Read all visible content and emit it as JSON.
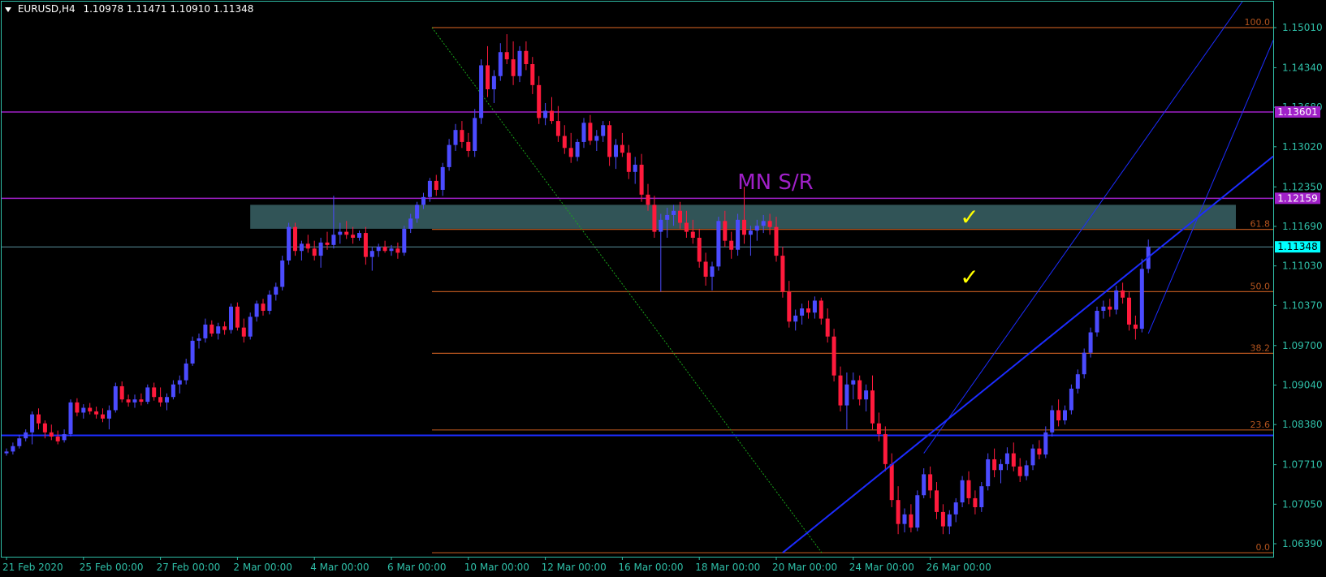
{
  "header": {
    "symbol": "EURUSD,H4",
    "ohlc": "1.10978 1.11471 1.10910 1.11348"
  },
  "colors": {
    "background": "#000000",
    "axis": "#2fbfa8",
    "bull": "#4b4bff",
    "bear": "#ff1a3c",
    "fib": "#b4541e",
    "sr": "#a020c8",
    "trend": "#1c2cff",
    "zone": "#3a6366",
    "check": "#ffff00",
    "price_box": "#00ffff"
  },
  "chart_data": {
    "type": "candlestick",
    "y_ticks": [
      "1.15010",
      "1.14340",
      "1.13680",
      "1.13020",
      "1.12350",
      "1.11690",
      "1.11030",
      "1.10370",
      "1.09700",
      "1.09040",
      "1.08380",
      "1.07710",
      "1.07050",
      "1.06390"
    ],
    "ylim": [
      1.0615,
      1.1551
    ],
    "x_ticks": [
      {
        "label": "21 Feb 2020",
        "index": 0
      },
      {
        "label": "25 Feb 00:00",
        "index": 12
      },
      {
        "label": "27 Feb 00:00",
        "index": 24
      },
      {
        "label": "2 Mar 00:00",
        "index": 36
      },
      {
        "label": "4 Mar 00:00",
        "index": 48
      },
      {
        "label": "6 Mar 00:00",
        "index": 60
      },
      {
        "label": "10 Mar 00:00",
        "index": 72
      },
      {
        "label": "12 Mar 00:00",
        "index": 84
      },
      {
        "label": "16 Mar 00:00",
        "index": 96
      },
      {
        "label": "18 Mar 00:00",
        "index": 108
      },
      {
        "label": "20 Mar 00:00",
        "index": 120
      },
      {
        "label": "24 Mar 00:00",
        "index": 132
      },
      {
        "label": "26 Mar 00:00",
        "index": 144
      }
    ],
    "candles": [
      [
        1.079,
        1.0798,
        1.0786,
        1.0793
      ],
      [
        1.0793,
        1.0808,
        1.0788,
        1.0802
      ],
      [
        1.0802,
        1.0821,
        1.0798,
        1.0815
      ],
      [
        1.0815,
        1.083,
        1.081,
        1.0825
      ],
      [
        1.0825,
        1.086,
        1.0805,
        1.0855
      ],
      [
        1.0855,
        1.0865,
        1.083,
        1.084
      ],
      [
        1.084,
        1.0845,
        1.0815,
        1.0825
      ],
      [
        1.0825,
        1.0838,
        1.0812,
        1.0818
      ],
      [
        1.0818,
        1.0828,
        1.0805,
        1.081
      ],
      [
        1.0812,
        1.083,
        1.0808,
        1.0822
      ],
      [
        1.0822,
        1.088,
        1.0818,
        1.0875
      ],
      [
        1.0875,
        1.0882,
        1.0852,
        1.0858
      ],
      [
        1.0858,
        1.0872,
        1.0848,
        1.0866
      ],
      [
        1.0866,
        1.0874,
        1.0855,
        1.086
      ],
      [
        1.086,
        1.0868,
        1.0848,
        1.0855
      ],
      [
        1.0855,
        1.0865,
        1.0842,
        1.0848
      ],
      [
        1.0848,
        1.087,
        1.083,
        1.0862
      ],
      [
        1.0862,
        1.0908,
        1.0858,
        1.0902
      ],
      [
        1.0902,
        1.091,
        1.0875,
        1.088
      ],
      [
        1.088,
        1.0888,
        1.0868,
        1.0875
      ],
      [
        1.0875,
        1.0888,
        1.0866,
        1.088
      ],
      [
        1.088,
        1.089,
        1.087,
        1.0876
      ],
      [
        1.0876,
        1.0905,
        1.0872,
        1.09
      ],
      [
        1.09,
        1.0908,
        1.0878,
        1.0884
      ],
      [
        1.0884,
        1.09,
        1.0868,
        1.0875
      ],
      [
        1.0875,
        1.089,
        1.0862,
        1.0884
      ],
      [
        1.0884,
        1.0912,
        1.088,
        1.0905
      ],
      [
        1.0905,
        1.092,
        1.089,
        1.0912
      ],
      [
        1.0912,
        1.0948,
        1.0905,
        1.094
      ],
      [
        1.094,
        1.0985,
        1.0936,
        1.0978
      ],
      [
        1.0978,
        1.099,
        1.0965,
        1.0982
      ],
      [
        1.0982,
        1.1015,
        1.0975,
        1.1005
      ],
      [
        1.1005,
        1.1012,
        1.0985,
        1.099
      ],
      [
        1.099,
        1.1008,
        1.098,
        1.1002
      ],
      [
        1.1002,
        1.101,
        1.0988,
        1.0996
      ],
      [
        1.0996,
        1.104,
        1.099,
        1.1035
      ],
      [
        1.1035,
        1.1042,
        1.0995,
        1.1
      ],
      [
        1.1,
        1.1015,
        1.0975,
        1.0985
      ],
      [
        1.0985,
        1.1025,
        1.098,
        1.1018
      ],
      [
        1.1018,
        1.1045,
        1.101,
        1.104
      ],
      [
        1.104,
        1.1048,
        1.102,
        1.1028
      ],
      [
        1.1028,
        1.1062,
        1.1022,
        1.1055
      ],
      [
        1.1055,
        1.1075,
        1.1045,
        1.1068
      ],
      [
        1.1068,
        1.112,
        1.1062,
        1.1112
      ],
      [
        1.1112,
        1.1175,
        1.1105,
        1.1168
      ],
      [
        1.1168,
        1.1175,
        1.112,
        1.1128
      ],
      [
        1.1128,
        1.1145,
        1.1112,
        1.114
      ],
      [
        1.114,
        1.1155,
        1.1125,
        1.1132
      ],
      [
        1.1132,
        1.1145,
        1.1112,
        1.112
      ],
      [
        1.112,
        1.115,
        1.11,
        1.1142
      ],
      [
        1.1142,
        1.116,
        1.113,
        1.1138
      ],
      [
        1.1138,
        1.122,
        1.1132,
        1.1155
      ],
      [
        1.1155,
        1.1175,
        1.114,
        1.116
      ],
      [
        1.116,
        1.1178,
        1.1148,
        1.1155
      ],
      [
        1.1155,
        1.1168,
        1.114,
        1.115
      ],
      [
        1.115,
        1.1162,
        1.1145,
        1.1158
      ],
      [
        1.1158,
        1.1168,
        1.1105,
        1.1118
      ],
      [
        1.1118,
        1.1135,
        1.1095,
        1.1128
      ],
      [
        1.1128,
        1.114,
        1.1118,
        1.1135
      ],
      [
        1.1135,
        1.1145,
        1.1125,
        1.1128
      ],
      [
        1.1128,
        1.1138,
        1.112,
        1.1132
      ],
      [
        1.1132,
        1.1142,
        1.1115,
        1.1125
      ],
      [
        1.1125,
        1.117,
        1.112,
        1.1165
      ],
      [
        1.1165,
        1.119,
        1.1158,
        1.1182
      ],
      [
        1.1182,
        1.121,
        1.1175,
        1.1205
      ],
      [
        1.1205,
        1.1225,
        1.1198,
        1.1218
      ],
      [
        1.1218,
        1.125,
        1.121,
        1.1245
      ],
      [
        1.1245,
        1.1255,
        1.122,
        1.123
      ],
      [
        1.123,
        1.1275,
        1.122,
        1.1268
      ],
      [
        1.1268,
        1.1315,
        1.1262,
        1.1305
      ],
      [
        1.1305,
        1.134,
        1.1295,
        1.133
      ],
      [
        1.133,
        1.1345,
        1.13,
        1.131
      ],
      [
        1.131,
        1.1325,
        1.1285,
        1.1295
      ],
      [
        1.1295,
        1.1365,
        1.1285,
        1.135
      ],
      [
        1.135,
        1.1448,
        1.134,
        1.1438
      ],
      [
        1.1438,
        1.147,
        1.1385,
        1.1398
      ],
      [
        1.1398,
        1.143,
        1.1375,
        1.142
      ],
      [
        1.142,
        1.1475,
        1.1412,
        1.146
      ],
      [
        1.146,
        1.149,
        1.144,
        1.1448
      ],
      [
        1.1448,
        1.1478,
        1.1405,
        1.142
      ],
      [
        1.142,
        1.147,
        1.141,
        1.1462
      ],
      [
        1.1462,
        1.1478,
        1.143,
        1.144
      ],
      [
        1.144,
        1.1452,
        1.139,
        1.1405
      ],
      [
        1.1405,
        1.142,
        1.134,
        1.135
      ],
      [
        1.135,
        1.1375,
        1.1338,
        1.1362
      ],
      [
        1.1362,
        1.1385,
        1.134,
        1.1345
      ],
      [
        1.1345,
        1.137,
        1.131,
        1.132
      ],
      [
        1.132,
        1.1338,
        1.129,
        1.13
      ],
      [
        1.13,
        1.1325,
        1.1275,
        1.1285
      ],
      [
        1.1285,
        1.1315,
        1.1278,
        1.131
      ],
      [
        1.131,
        1.135,
        1.13,
        1.1342
      ],
      [
        1.1342,
        1.1355,
        1.1305,
        1.1312
      ],
      [
        1.1312,
        1.133,
        1.1295,
        1.132
      ],
      [
        1.132,
        1.1345,
        1.131,
        1.1338
      ],
      [
        1.1338,
        1.1345,
        1.127,
        1.1285
      ],
      [
        1.1285,
        1.1315,
        1.1265,
        1.1305
      ],
      [
        1.1305,
        1.1325,
        1.1285,
        1.1292
      ],
      [
        1.1292,
        1.1305,
        1.1248,
        1.126
      ],
      [
        1.126,
        1.1285,
        1.124,
        1.1272
      ],
      [
        1.1272,
        1.129,
        1.121,
        1.1222
      ],
      [
        1.1222,
        1.124,
        1.1195,
        1.1205
      ],
      [
        1.1205,
        1.122,
        1.115,
        1.116
      ],
      [
        1.116,
        1.119,
        1.106,
        1.118
      ],
      [
        1.118,
        1.12,
        1.115,
        1.1188
      ],
      [
        1.1188,
        1.1205,
        1.117,
        1.1195
      ],
      [
        1.1195,
        1.121,
        1.1165,
        1.1175
      ],
      [
        1.1175,
        1.1195,
        1.115,
        1.116
      ],
      [
        1.116,
        1.118,
        1.114,
        1.115
      ],
      [
        1.115,
        1.1165,
        1.11,
        1.111
      ],
      [
        1.111,
        1.1125,
        1.107,
        1.1085
      ],
      [
        1.1085,
        1.111,
        1.1062,
        1.1102
      ],
      [
        1.1102,
        1.1185,
        1.1095,
        1.1178
      ],
      [
        1.1178,
        1.1195,
        1.1135,
        1.1145
      ],
      [
        1.1145,
        1.116,
        1.1115,
        1.113
      ],
      [
        1.113,
        1.119,
        1.112,
        1.118
      ],
      [
        1.118,
        1.1235,
        1.114,
        1.1155
      ],
      [
        1.1155,
        1.117,
        1.112,
        1.1162
      ],
      [
        1.1162,
        1.118,
        1.1145,
        1.117
      ],
      [
        1.117,
        1.1188,
        1.1158,
        1.1178
      ],
      [
        1.1178,
        1.119,
        1.1155,
        1.1168
      ],
      [
        1.1168,
        1.1185,
        1.111,
        1.112
      ],
      [
        1.112,
        1.1135,
        1.105,
        1.106
      ],
      [
        1.106,
        1.1078,
        1.1,
        1.101
      ],
      [
        1.101,
        1.103,
        1.0995,
        1.102
      ],
      [
        1.102,
        1.104,
        1.1005,
        1.1032
      ],
      [
        1.1032,
        1.1045,
        1.1015,
        1.1025
      ],
      [
        1.1025,
        1.1052,
        1.1015,
        1.1045
      ],
      [
        1.1045,
        1.105,
        1.1005,
        1.1015
      ],
      [
        1.1015,
        1.1032,
        1.0975,
        1.0985
      ],
      [
        1.0985,
        1.0998,
        1.091,
        1.092
      ],
      [
        1.092,
        1.0935,
        1.086,
        1.087
      ],
      [
        1.087,
        1.0925,
        1.083,
        1.0905
      ],
      [
        1.0905,
        1.0925,
        1.088,
        1.0912
      ],
      [
        1.0912,
        1.092,
        1.087,
        1.088
      ],
      [
        1.088,
        1.0905,
        1.086,
        1.0895
      ],
      [
        1.0895,
        1.092,
        1.083,
        1.084
      ],
      [
        1.084,
        1.0858,
        1.081,
        1.0822
      ],
      [
        1.0822,
        1.0835,
        1.076,
        1.0772
      ],
      [
        1.0772,
        1.079,
        1.07,
        1.0712
      ],
      [
        1.0712,
        1.0735,
        1.0655,
        1.0672
      ],
      [
        1.0672,
        1.0698,
        1.0658,
        1.0688
      ],
      [
        1.0688,
        1.0705,
        1.0658,
        1.0666
      ],
      [
        1.0666,
        1.0728,
        1.066,
        1.072
      ],
      [
        1.072,
        1.0765,
        1.0715,
        1.0755
      ],
      [
        1.0755,
        1.0768,
        1.0715,
        1.0728
      ],
      [
        1.0728,
        1.0742,
        1.068,
        1.0692
      ],
      [
        1.0692,
        1.0705,
        1.0655,
        1.0668
      ],
      [
        1.0668,
        1.0695,
        1.0655,
        1.0688
      ],
      [
        1.0688,
        1.0715,
        1.0675,
        1.0708
      ],
      [
        1.0708,
        1.0752,
        1.07,
        1.0745
      ],
      [
        1.0745,
        1.076,
        1.0705,
        1.0715
      ],
      [
        1.0715,
        1.0728,
        1.0688,
        1.07
      ],
      [
        1.07,
        1.0742,
        1.0692,
        1.0735
      ],
      [
        1.0735,
        1.079,
        1.0728,
        1.078
      ],
      [
        1.078,
        1.0798,
        1.075,
        1.0762
      ],
      [
        1.0762,
        1.078,
        1.074,
        1.0772
      ]
    ],
    "candles_tail": [
      [
        1.0772,
        1.08,
        1.0762,
        1.079
      ],
      [
        1.079,
        1.0808,
        1.076,
        1.0768
      ],
      [
        1.0768,
        1.0782,
        1.0742,
        1.0752
      ],
      [
        1.0752,
        1.0778,
        1.0745,
        1.077
      ],
      [
        1.077,
        1.0805,
        1.0762,
        1.0798
      ],
      [
        1.0798,
        1.0812,
        1.078,
        1.0788
      ],
      [
        1.0788,
        1.0835,
        1.0782,
        1.0825
      ],
      [
        1.0825,
        1.087,
        1.0818,
        1.0862
      ],
      [
        1.0862,
        1.088,
        1.0835,
        1.0845
      ],
      [
        1.0845,
        1.087,
        1.0838,
        1.0862
      ],
      [
        1.0862,
        1.0905,
        1.0855,
        1.0898
      ],
      [
        1.0898,
        1.093,
        1.089,
        1.0922
      ],
      [
        1.0922,
        1.0965,
        1.0915,
        1.0958
      ],
      [
        1.0958,
        1.1,
        1.095,
        1.0992
      ],
      [
        1.0992,
        1.1035,
        1.0985,
        1.1028
      ],
      [
        1.1028,
        1.1045,
        1.1015,
        1.1035
      ],
      [
        1.1035,
        1.1048,
        1.1018,
        1.103
      ],
      [
        1.103,
        1.107,
        1.1022,
        1.1062
      ],
      [
        1.1062,
        1.1075,
        1.104,
        1.105
      ],
      [
        1.105,
        1.106,
        1.0995,
        1.1005
      ],
      [
        1.1005,
        1.102,
        1.098,
        1.0998
      ],
      [
        1.0998,
        1.1115,
        1.0992,
        1.1098
      ],
      [
        1.1098,
        1.1147,
        1.1091,
        1.1135
      ]
    ],
    "fib_levels": [
      {
        "label": "100.0",
        "price": 1.1501
      },
      {
        "label": "61.8",
        "price": 1.1164
      },
      {
        "label": "50.0",
        "price": 1.106
      },
      {
        "label": "38.2",
        "price": 1.0957
      },
      {
        "label": "23.6",
        "price": 1.0829
      },
      {
        "label": "0.0",
        "price": 1.0624
      }
    ],
    "sr_levels": [
      {
        "label": "1.13601",
        "price": 1.13601
      },
      {
        "label": "1.12159",
        "price": 1.12159
      }
    ],
    "sr_annotation": "MN S/R",
    "support_line_price": 1.082,
    "current_price": "1.11348",
    "current_price_value": 1.11348,
    "zone": {
      "top": 1.1205,
      "bottom": 1.1165
    },
    "checkmarks": [
      "✓",
      "✓"
    ],
    "grid": false
  }
}
